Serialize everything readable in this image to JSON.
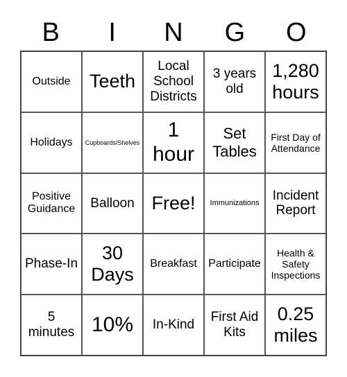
{
  "header": {
    "letters": [
      "B",
      "I",
      "N",
      "G",
      "O"
    ]
  },
  "board": {
    "rows": [
      [
        "Outside",
        "Teeth",
        "Local School Districts",
        "3 years old",
        "1,280 hours"
      ],
      [
        "Holidays",
        "Cupboards/Shelves",
        "1 hour",
        "Set Tables",
        "First Day of Attendance"
      ],
      [
        "Positive Guidance",
        "Balloon",
        "Free!",
        "Immunizations",
        "Incident Report"
      ],
      [
        "Phase-In",
        "30 Days",
        "Breakfast",
        "Participate",
        "Health & Safety Inspections"
      ],
      [
        "5 minutes",
        "10%",
        "In-Kind",
        "First Aid Kits",
        "0.25 miles"
      ]
    ]
  }
}
